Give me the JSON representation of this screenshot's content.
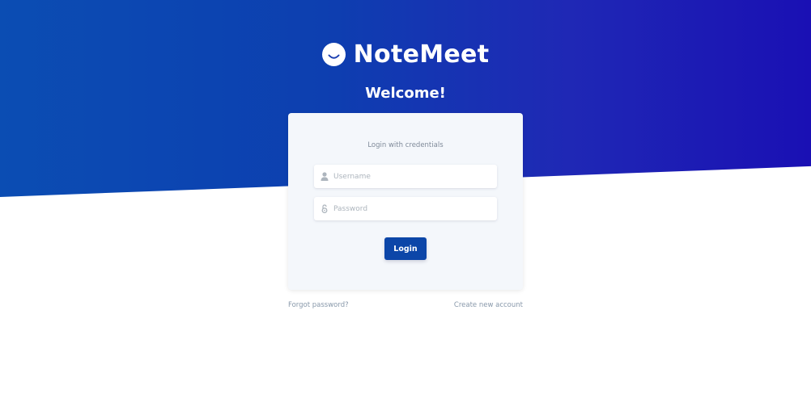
{
  "brand": {
    "name": "NoteMeet",
    "logo_icon": "smile-icon"
  },
  "welcome": "Welcome!",
  "login_card": {
    "subtitle": "Login with credentials",
    "username": {
      "placeholder": "Username",
      "value": "",
      "icon": "user-icon"
    },
    "password": {
      "placeholder": "Password",
      "value": "",
      "icon": "lock-icon"
    },
    "login_label": "Login"
  },
  "links": {
    "forgot_password": "Forgot password?",
    "create_account": "Create new account"
  },
  "colors": {
    "hero_gradient_start": "#0b4db3",
    "hero_gradient_end": "#1a10b4",
    "button": "#0c46a8",
    "card_bg": "#f4f7fb",
    "link": "#8898aa"
  }
}
